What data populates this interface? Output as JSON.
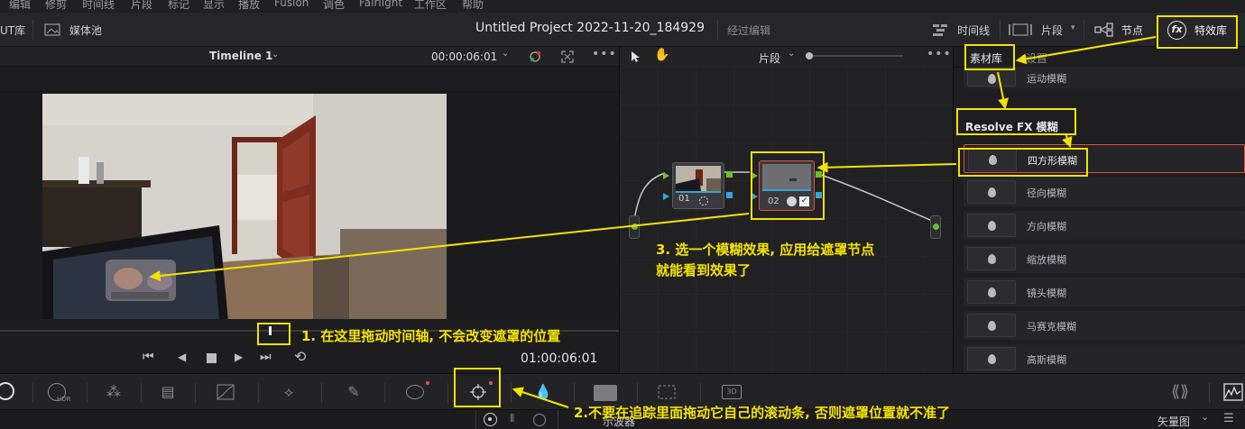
{
  "menu": [
    "编辑",
    "修剪",
    "时间线",
    "片段",
    "标记",
    "显示",
    "播放",
    "Fusion",
    "调色",
    "Fairlight",
    "工作区",
    "帮助"
  ],
  "titlebar": {
    "lut_label": "UT库",
    "media_pool": "媒体池",
    "project_title": "Untitled Project 2022-11-20_184929",
    "edited_status": "经过编辑",
    "timeline_btn": "时间线",
    "clips_btn": "片段",
    "nodes_btn": "节点",
    "effects_btn": "特效库",
    "fx_icon": "fx"
  },
  "viewer": {
    "timeline_name": "Timeline 1",
    "timecode_top": "00:00:06:01",
    "timecode_bottom": "01:00:06:01"
  },
  "node_editor": {
    "mode": "片段",
    "node1_label": "01",
    "node2_label": "02"
  },
  "effects": {
    "tab_library": "素材库",
    "tab_settings": "设置",
    "section_resolve_fx": "Resolve FX 模糊",
    "items": [
      "运动模糊",
      "四方形模糊",
      "径向模糊",
      "方向模糊",
      "缩放模糊",
      "镜头模糊",
      "马赛克模糊",
      "高斯模糊"
    ]
  },
  "toolbar": {
    "hdr_label": "HDR",
    "three_d_label": "3D"
  },
  "bottombar": {
    "scope_label": "示波器",
    "vectorscope_label": "矢量图"
  },
  "annotations": {
    "step1": "1. 在这里拖动时间轴, 不会改变遮罩的位置",
    "step2": "2.不要在追踪里面拖动它自己的滚动条, 否则遮罩位置就不准了",
    "step3_line1": "3. 选一个模糊效果, 应用给遮罩节点",
    "step3_line2": "就能看到效果了"
  },
  "colors": {
    "annotation_yellow": "#f4e300",
    "selected_outline": "#e2513e"
  }
}
